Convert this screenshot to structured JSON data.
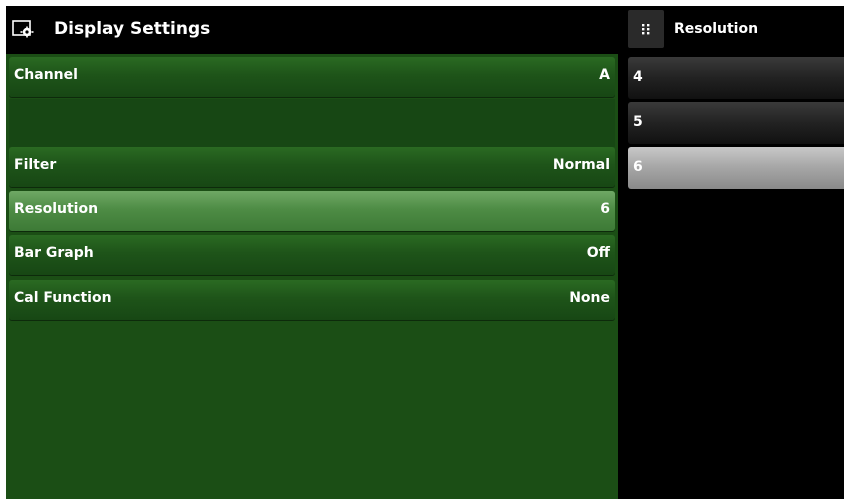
{
  "header": {
    "title": "Display Settings",
    "icon": "display-settings-icon"
  },
  "settings": {
    "channel": {
      "label": "Channel",
      "value": "A"
    },
    "filter": {
      "label": "Filter",
      "value": "Normal"
    },
    "resolution": {
      "label": "Resolution",
      "value": "6"
    },
    "bar_graph": {
      "label": "Bar Graph",
      "value": "Off"
    },
    "cal_function": {
      "label": "Cal Function",
      "value": "None"
    }
  },
  "selector": {
    "title": "Resolution",
    "icon": "grip-dots-icon",
    "options": [
      "4",
      "5",
      "6"
    ],
    "selected": "6"
  },
  "colors": {
    "panel_green": "#1b4e15",
    "selected_row_green": "#4e8c45",
    "selected_option_gray": "#a8a8a8",
    "background": "#000000"
  }
}
